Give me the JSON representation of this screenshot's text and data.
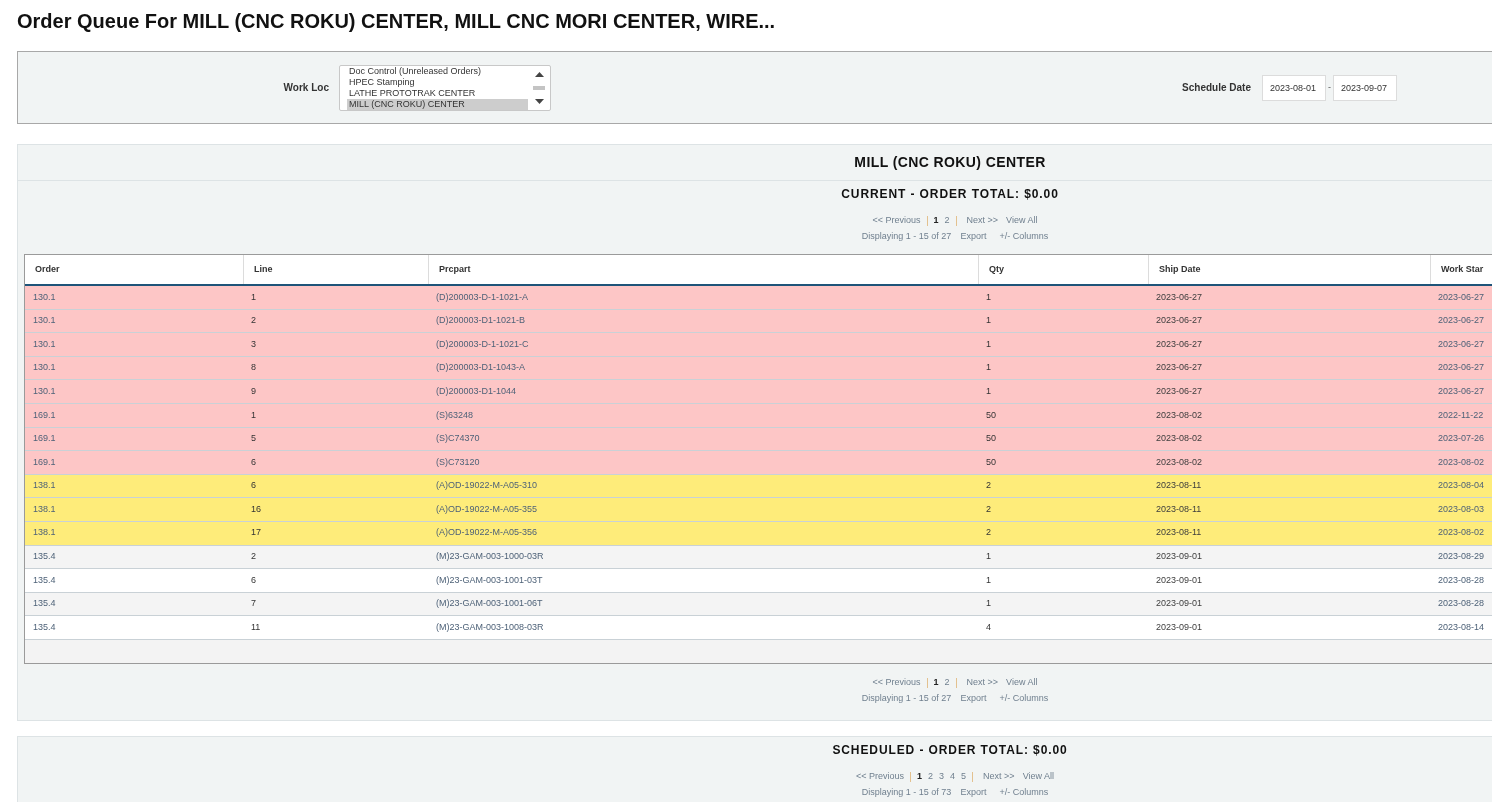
{
  "page": {
    "title": "Order Queue For MILL (CNC ROKU) CENTER, MILL CNC MORI CENTER, WIRE..."
  },
  "filters": {
    "work_loc": {
      "label": "Work Loc",
      "options": [
        {
          "label": "Doc Control (Unreleased Orders)",
          "selected": false
        },
        {
          "label": "HPEC Stamping",
          "selected": false
        },
        {
          "label": "LATHE PROTOTRAK CENTER",
          "selected": false
        },
        {
          "label": "MILL (CNC ROKU) CENTER",
          "selected": true
        }
      ]
    },
    "schedule_date": {
      "label": "Schedule Date",
      "from": "2023-08-01",
      "separator": "-",
      "to": "2023-09-07"
    }
  },
  "work_center": {
    "title": "MILL (CNC ROKU) CENTER"
  },
  "sections": [
    {
      "title": "CURRENT - ORDER TOTAL: $0.00",
      "pager_top": {
        "previous": "<< Previous",
        "pages": [
          {
            "label": "1",
            "selected": true
          },
          {
            "label": "2",
            "selected": false
          }
        ],
        "next": "Next >>",
        "view_all": "View All",
        "displaying": "Displaying 1 - 15 of 27",
        "export": "Export",
        "columns": "+/- Columns"
      },
      "table": {
        "columns": [
          "Order",
          "Line",
          "Prcpart",
          "Qty",
          "Ship Date",
          "Work Star"
        ],
        "rows": [
          {
            "cells": [
              "130.1",
              "1",
              "(D)200003-D-1-1021-A",
              "1",
              "2023-06-27",
              "2023-06-27"
            ],
            "color": "#fdc6c6"
          },
          {
            "cells": [
              "130.1",
              "2",
              "(D)200003-D1-1021-B",
              "1",
              "2023-06-27",
              "2023-06-27"
            ],
            "color": "#fdc6c6"
          },
          {
            "cells": [
              "130.1",
              "3",
              "(D)200003-D-1-1021-C",
              "1",
              "2023-06-27",
              "2023-06-27"
            ],
            "color": "#fdc6c6"
          },
          {
            "cells": [
              "130.1",
              "8",
              "(D)200003-D1-1043-A",
              "1",
              "2023-06-27",
              "2023-06-27"
            ],
            "color": "#fdc6c6"
          },
          {
            "cells": [
              "130.1",
              "9",
              "(D)200003-D1-1044",
              "1",
              "2023-06-27",
              "2023-06-27"
            ],
            "color": "#fdc6c6"
          },
          {
            "cells": [
              "169.1",
              "1",
              "(S)63248",
              "50",
              "2023-08-02",
              "2022-11-22"
            ],
            "color": "#fdc6c6"
          },
          {
            "cells": [
              "169.1",
              "5",
              "(S)C74370",
              "50",
              "2023-08-02",
              "2023-07-26"
            ],
            "color": "#fdc6c6"
          },
          {
            "cells": [
              "169.1",
              "6",
              "(S)C73120",
              "50",
              "2023-08-02",
              "2023-08-02"
            ],
            "color": "#fdc6c6"
          },
          {
            "cells": [
              "138.1",
              "6",
              "(A)OD-19022-M-A05-310",
              "2",
              "2023-08-11",
              "2023-08-04"
            ],
            "color": "#feec7a"
          },
          {
            "cells": [
              "138.1",
              "16",
              "(A)OD-19022-M-A05-355",
              "2",
              "2023-08-11",
              "2023-08-03"
            ],
            "color": "#feec7a"
          },
          {
            "cells": [
              "138.1",
              "17",
              "(A)OD-19022-M-A05-356",
              "2",
              "2023-08-11",
              "2023-08-02"
            ],
            "color": "#feec7a"
          },
          {
            "cells": [
              "135.4",
              "2",
              "(M)23-GAM-003-1000-03R",
              "1",
              "2023-09-01",
              "2023-08-29"
            ]
          },
          {
            "cells": [
              "135.4",
              "6",
              "(M)23-GAM-003-1001-03T",
              "1",
              "2023-09-01",
              "2023-08-28"
            ]
          },
          {
            "cells": [
              "135.4",
              "7",
              "(M)23-GAM-003-1001-06T",
              "1",
              "2023-09-01",
              "2023-08-28"
            ]
          },
          {
            "cells": [
              "135.4",
              "11",
              "(M)23-GAM-003-1008-03R",
              "4",
              "2023-09-01",
              "2023-08-14"
            ]
          }
        ]
      },
      "pager_bottom": {
        "previous": "<< Previous",
        "pages": [
          {
            "label": "1",
            "selected": true
          },
          {
            "label": "2",
            "selected": false
          }
        ],
        "next": "Next >>",
        "view_all": "View All",
        "displaying": "Displaying 1 - 15 of 27",
        "export": "Export",
        "columns": "+/- Columns"
      }
    },
    {
      "title": "SCHEDULED - ORDER TOTAL: $0.00",
      "pager_top": {
        "previous": "<< Previous",
        "pages": [
          {
            "label": "1",
            "selected": true
          },
          {
            "label": "2",
            "selected": false
          },
          {
            "label": "3",
            "selected": false
          },
          {
            "label": "4",
            "selected": false
          },
          {
            "label": "5",
            "selected": false
          }
        ],
        "next": "Next >>",
        "view_all": "View All",
        "displaying": "Displaying 1 - 15 of 73",
        "export": "Export",
        "columns": "+/- Columns"
      }
    }
  ]
}
